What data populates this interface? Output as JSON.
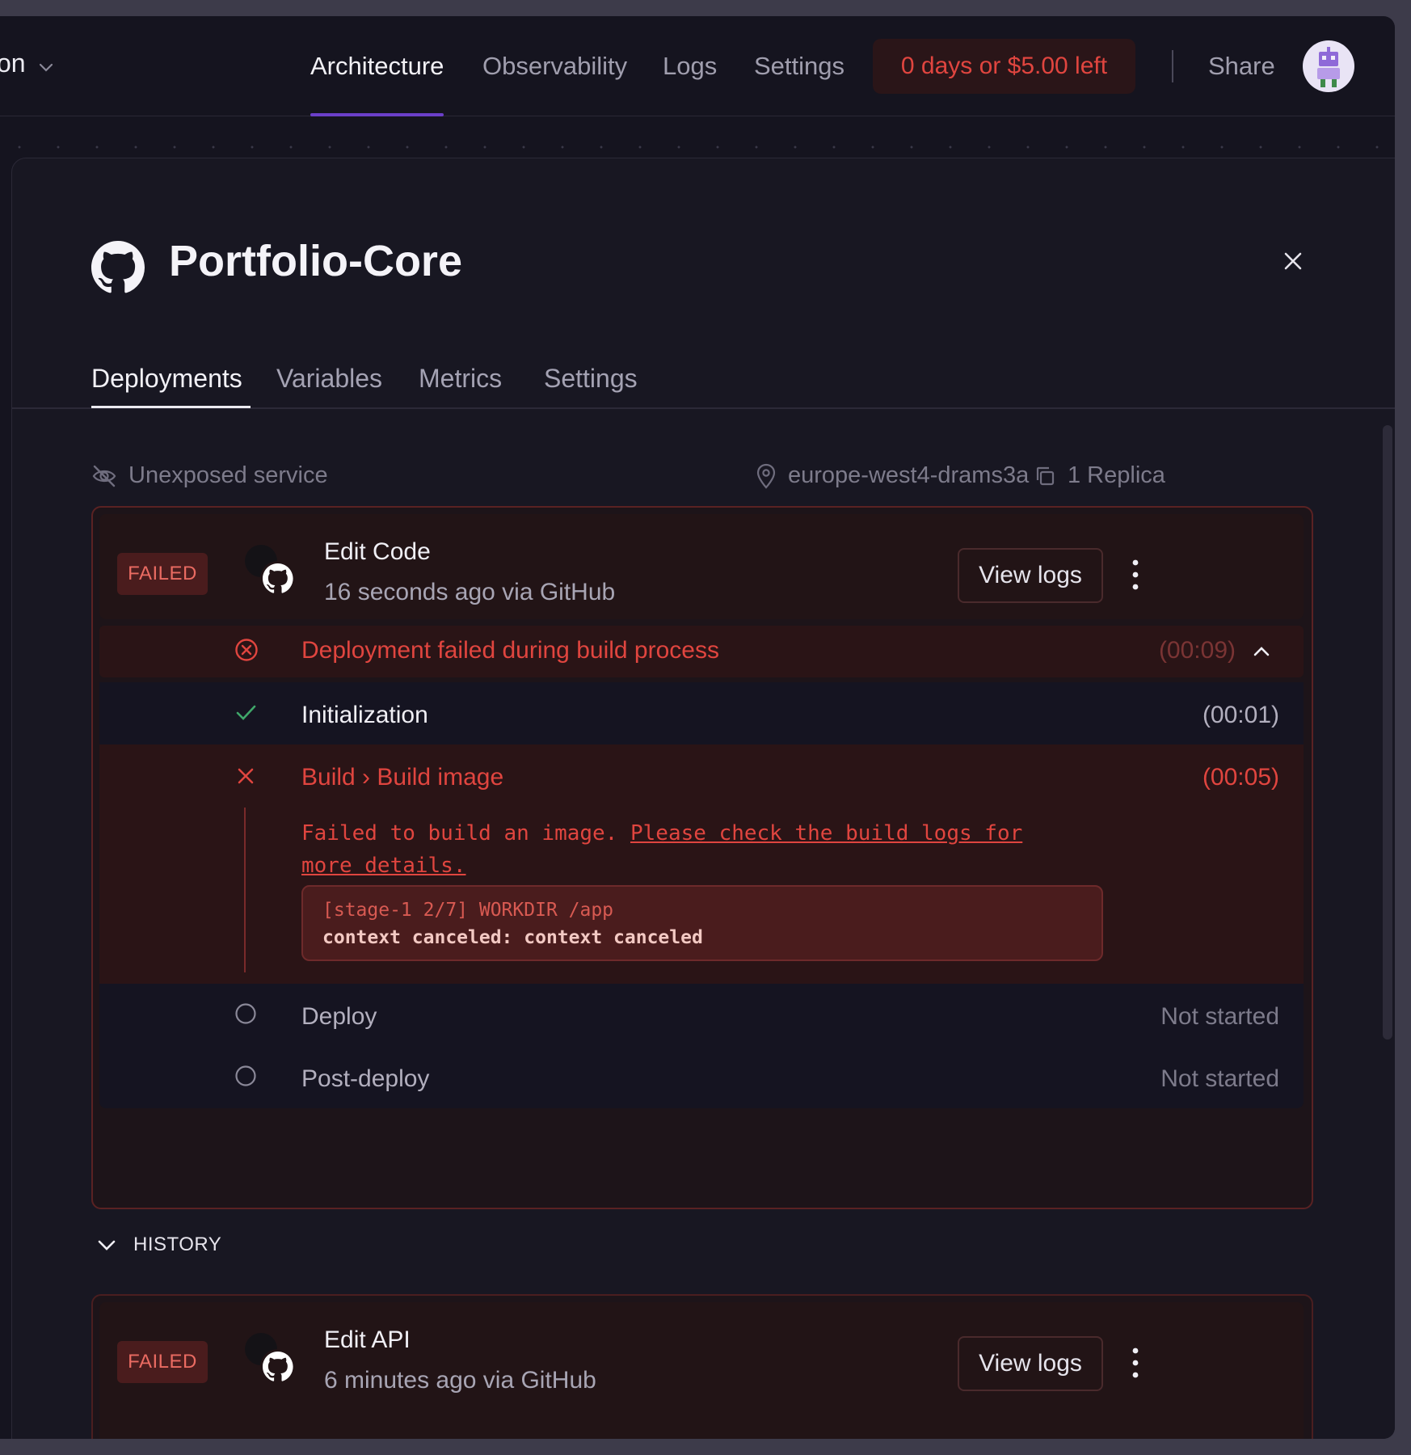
{
  "topnav": {
    "project_name_partial": "on",
    "links": [
      "Architecture",
      "Observability",
      "Logs",
      "Settings"
    ],
    "trial_label": "0 days or $5.00 left",
    "share_label": "Share",
    "avatar_icon": "robot-avatar-icon"
  },
  "service": {
    "title": "Portfolio-Core",
    "icon": "github-icon",
    "tabs": [
      "Deployments",
      "Variables",
      "Metrics",
      "Settings"
    ],
    "exposure": "Unexposed service",
    "region": "europe-west4-drams3a",
    "replicas": "1 Replica"
  },
  "current_deployment": {
    "status": "FAILED",
    "title": "Edit Code",
    "subtitle": "16 seconds ago via GitHub",
    "view_logs_label": "View logs",
    "failure_summary": "Deployment failed during build process",
    "failure_time": "(00:09)",
    "steps": [
      {
        "label": "Initialization",
        "time": "(00:01)",
        "status": "success"
      },
      {
        "label": "Build › Build image",
        "time": "(00:05)",
        "status": "failed"
      },
      {
        "label": "Deploy",
        "time": "Not started",
        "status": "pending"
      },
      {
        "label": "Post-deploy",
        "time": "Not started",
        "status": "pending"
      }
    ],
    "error_text": "Failed to build an image.",
    "error_link": "Please check the build logs for more details.",
    "log_line_1": "[stage-1 2/7] WORKDIR /app",
    "log_line_2": "context canceled: context canceled"
  },
  "history": {
    "label": "HISTORY",
    "items": [
      {
        "status": "FAILED",
        "title": "Edit API",
        "subtitle": "6 minutes ago via GitHub",
        "view_logs_label": "View logs"
      }
    ]
  },
  "colors": {
    "accent": "#6b3fc9",
    "error": "#e0453f",
    "success": "#3fa76a"
  }
}
